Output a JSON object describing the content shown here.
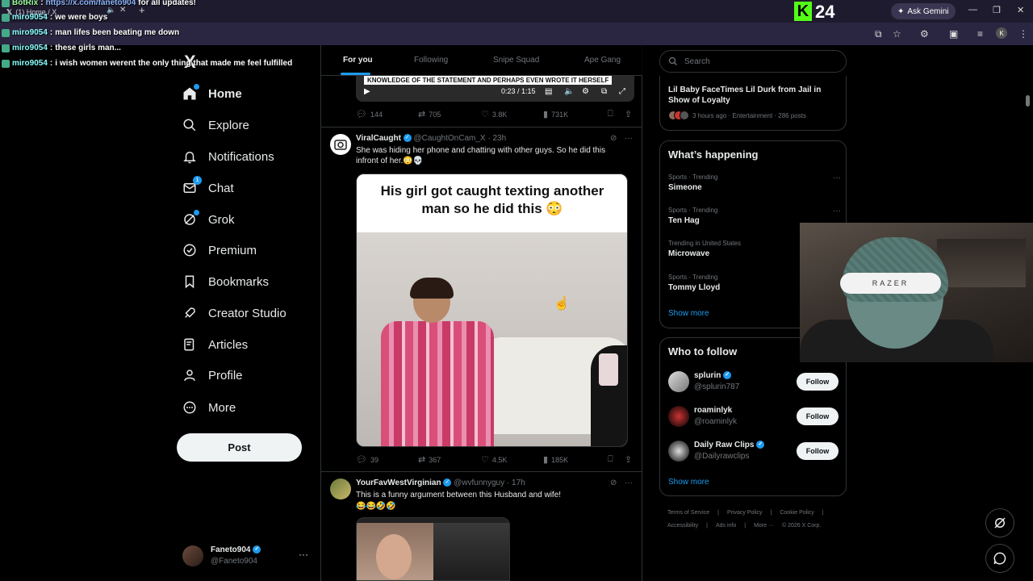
{
  "browser": {
    "tab_title": "(1) Home / X",
    "ask_gemini": "Ask Gemini",
    "profile_initial": "K"
  },
  "kick": {
    "viewer_count": "24"
  },
  "chat": [
    {
      "user": "BotRix",
      "sep": " : ",
      "link": "https://x.com/faneto904",
      "msg": " for all updates!"
    },
    {
      "user": "miro9054",
      "sep": " : ",
      "link": "",
      "msg": "we were boys"
    },
    {
      "user": "miro9054",
      "sep": " : ",
      "link": "",
      "msg": "man lifes been beating me down"
    },
    {
      "user": "miro9054",
      "sep": " : ",
      "link": "",
      "msg": "these girls man..."
    },
    {
      "user": "miro9054",
      "sep": " : ",
      "link": "",
      "msg": "i wish women werent the only thing that made me feel fulfilled"
    }
  ],
  "nav": {
    "logo": "X",
    "items": [
      {
        "label": "Home",
        "icon": "home-icon"
      },
      {
        "label": "Explore",
        "icon": "search-icon"
      },
      {
        "label": "Notifications",
        "icon": "bell-icon"
      },
      {
        "label": "Chat",
        "icon": "mail-icon",
        "badge": "1"
      },
      {
        "label": "Grok",
        "icon": "grok-icon"
      },
      {
        "label": "Premium",
        "icon": "premium-icon"
      },
      {
        "label": "Bookmarks",
        "icon": "bookmark-icon"
      },
      {
        "label": "Creator Studio",
        "icon": "rocket-icon"
      },
      {
        "label": "Articles",
        "icon": "article-icon"
      },
      {
        "label": "Profile",
        "icon": "person-icon"
      },
      {
        "label": "More",
        "icon": "more-icon"
      }
    ],
    "post_label": "Post"
  },
  "account": {
    "name": "Faneto904",
    "handle": "@Faneto904",
    "more": "···"
  },
  "feed_tabs": [
    "For you",
    "Following",
    "Snipe Squad",
    "Ape Gang"
  ],
  "prev_tweet": {
    "caption": "KNOWLEDGE OF THE STATEMENT AND PERHAPS EVEN WROTE IT HERSELF",
    "time": "0:23 / 1:15",
    "replies": "144",
    "reposts": "705",
    "likes": "3.8K",
    "views": "731K"
  },
  "tweet1": {
    "name": "ViralCaught",
    "handle": "@CaughtOnCam_X",
    "time": "· 23h",
    "text": "She was hiding her phone and chatting with other guys. So he did this infront of her.😳💀",
    "media_banner": "His girl got caught texting another man so he did this 😳",
    "replies": "39",
    "reposts": "367",
    "likes": "4.5K",
    "views": "185K"
  },
  "tweet2": {
    "name": "YourFavWestVirginian",
    "handle": "@wvfunnyguy",
    "time": "· 17h",
    "text": "This is a  funny argument between this Husband and wife!",
    "emoji": "😂😂🤣🤣"
  },
  "right": {
    "search_placeholder": "Search",
    "news": {
      "title": "Lil Baby FaceTimes Lil Durk from Jail in Show of Loyalty",
      "meta": "3 hours ago · Entertainment · 286 posts"
    },
    "whats_happening": {
      "title": "What’s happening",
      "trends": [
        {
          "category": "Sports · Trending",
          "name": "Simeone"
        },
        {
          "category": "Sports · Trending",
          "name": "Ten Hag"
        },
        {
          "category": "Trending in United States",
          "name": "Microwave"
        },
        {
          "category": "Sports · Trending",
          "name": "Tommy Lloyd"
        }
      ],
      "show_more": "Show more"
    },
    "who_to_follow": {
      "title": "Who to follow",
      "accounts": [
        {
          "name": "splurin",
          "handle": "@splurin787",
          "verified": true
        },
        {
          "name": "roaminlyk",
          "handle": "@roaminlyk",
          "verified": false
        },
        {
          "name": "Daily Raw Clips",
          "handle": "@Dailyrawclips",
          "verified": true
        }
      ],
      "follow_label": "Follow",
      "show_more": "Show more"
    },
    "footer": [
      "Terms of Service",
      "|",
      "Privacy Policy",
      "|",
      "Cookie Policy",
      "|",
      "Accessibility",
      "|",
      "Ads info",
      "|",
      "More ···",
      "© 2026 X Corp."
    ]
  },
  "webcam": {
    "band_text": "RAZER"
  }
}
